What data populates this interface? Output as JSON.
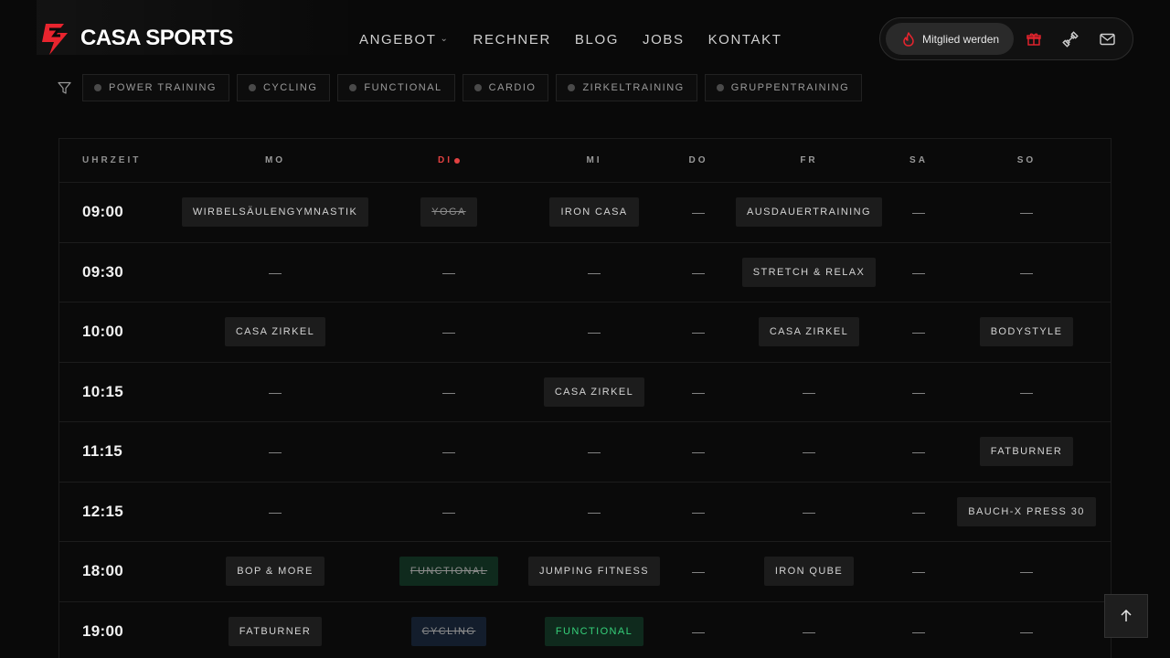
{
  "brand": {
    "name": "CASA SPORTS",
    "accent": "#e8242e"
  },
  "nav": [
    {
      "label": "ANGEBOT",
      "has_dropdown": true
    },
    {
      "label": "RECHNER"
    },
    {
      "label": "BLOG"
    },
    {
      "label": "JOBS"
    },
    {
      "label": "KONTAKT"
    }
  ],
  "actions": {
    "member_label": "Mitglied werden",
    "icons": [
      "flame-icon",
      "gift-icon",
      "dumbbell-icon",
      "mail-icon"
    ]
  },
  "filters": [
    "POWER TRAINING",
    "CYCLING",
    "FUNCTIONAL",
    "CARDIO",
    "ZIRKELTRAINING",
    "GRUPPENTRAINING"
  ],
  "schedule": {
    "time_header": "UHRZEIT",
    "days": [
      "MO",
      "DI",
      "MI",
      "DO",
      "FR",
      "SA",
      "SO"
    ],
    "today_index": 1,
    "rows": [
      {
        "time": "09:00",
        "cells": [
          {
            "label": "WIRBELSÄULENGYMNASTIK"
          },
          {
            "label": "YOGA",
            "style": "cancelled"
          },
          {
            "label": "IRON CASA"
          },
          null,
          {
            "label": "AUSDAUERTRAINING"
          },
          null,
          null
        ]
      },
      {
        "time": "09:30",
        "cells": [
          null,
          null,
          null,
          null,
          {
            "label": "STRETCH & RELAX"
          },
          null,
          null
        ]
      },
      {
        "time": "10:00",
        "cells": [
          {
            "label": "CASA ZIRKEL"
          },
          null,
          null,
          null,
          {
            "label": "CASA ZIRKEL"
          },
          null,
          {
            "label": "BODYSTYLE"
          }
        ]
      },
      {
        "time": "10:15",
        "cells": [
          null,
          null,
          {
            "label": "CASA ZIRKEL"
          },
          null,
          null,
          null,
          null
        ]
      },
      {
        "time": "11:15",
        "cells": [
          null,
          null,
          null,
          null,
          null,
          null,
          {
            "label": "FATBURNER"
          }
        ]
      },
      {
        "time": "12:15",
        "cells": [
          null,
          null,
          null,
          null,
          null,
          null,
          {
            "label": "BAUCH-X PRESS 30"
          }
        ]
      },
      {
        "time": "18:00",
        "cells": [
          {
            "label": "BOP & MORE"
          },
          {
            "label": "FUNCTIONAL",
            "style": "cancelled-green"
          },
          {
            "label": "JUMPING FITNESS"
          },
          null,
          {
            "label": "IRON QUBE"
          },
          null,
          null
        ]
      },
      {
        "time": "19:00",
        "cells": [
          {
            "label": "FATBURNER"
          },
          {
            "label": "CYCLING",
            "style": "cancelled-blue"
          },
          {
            "label": "FUNCTIONAL",
            "style": "functional-green"
          },
          null,
          null,
          null,
          null
        ]
      }
    ],
    "empty_symbol": "—"
  },
  "colors": {
    "today": "#e24141",
    "functional_text": "#36d07a",
    "functional_bg": "#0f2a1d",
    "cycling_bg": "#131d2c"
  }
}
